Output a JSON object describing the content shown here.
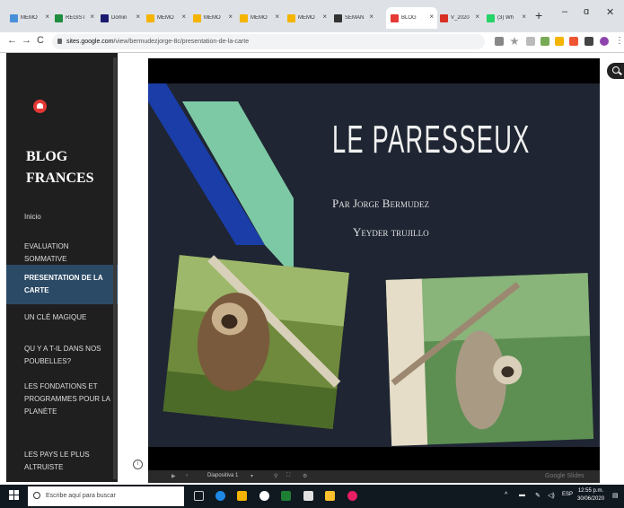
{
  "browser": {
    "tabs": [
      {
        "label": "MEMO",
        "color": "#4a90d9"
      },
      {
        "label": "REGIST",
        "color": "#1e8e3e"
      },
      {
        "label": "Domin",
        "color": "#1a1a6e"
      },
      {
        "label": "MEMO",
        "color": "#f4b400"
      },
      {
        "label": "MEMO",
        "color": "#f4b400"
      },
      {
        "label": "MEMO",
        "color": "#f4b400"
      },
      {
        "label": "MEMO",
        "color": "#f4b400"
      },
      {
        "label": "SEMAN",
        "color": "#333333"
      },
      {
        "label": "BLOG",
        "color": "#e53935",
        "active": true
      },
      {
        "label": "V_2020",
        "color": "#d93025"
      },
      {
        "label": "(3) Wh",
        "color": "#25d366"
      }
    ],
    "new_tab": "+",
    "minimize": "–",
    "restore": "ɑ",
    "close": "✕",
    "back": "←",
    "forward": "→",
    "reload": "C",
    "url_host": "sites.google.com",
    "url_path": "/view/bermudezjorge-8c/presentation-de-la-carte"
  },
  "sidebar": {
    "title_line1": "BLOG",
    "title_line2": "FRANCES",
    "items": [
      {
        "label": "Inicio"
      },
      {
        "label": "EVALUATION SOMMATIVE"
      },
      {
        "label": "PRESENTATION DE LA CARTE",
        "active": true
      },
      {
        "label": "UN CLÉ MAGIQUE"
      },
      {
        "label": "QU Y A T-IL DANS NOS POUBELLES?"
      },
      {
        "label": "LES FONDATIONS ET PROGRAMMES POUR LA PLANÈTE"
      },
      {
        "label": "LES PAYS LE PLUS ALTRUISTE"
      }
    ]
  },
  "slide": {
    "title": "LE PARESSEUX",
    "author_line1": "Par Jorge Bermudez",
    "author_line2": "Yeyder trujillo"
  },
  "controls": {
    "slide_label": "Diapositiva 1",
    "brand": "Google Slides"
  },
  "info_icon_label": "i",
  "taskbar": {
    "search_placeholder": "Escribe aquí para buscar",
    "lang": "ESP",
    "time": "12:55 p.m.",
    "date": "30/06/2020"
  }
}
